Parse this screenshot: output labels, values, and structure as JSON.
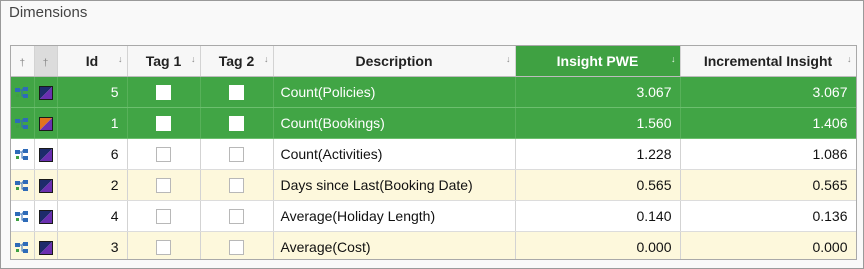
{
  "panel_title": "Dimensions",
  "columns": {
    "pin1": "†",
    "pin2": "†",
    "id": "Id",
    "tag1": "Tag 1",
    "tag2": "Tag 2",
    "description": "Description",
    "insight_pwe": "Insight PWE",
    "incremental_insight": "Incremental Insight"
  },
  "pin_glyph": "↓",
  "colors": {
    "selected_row": "#41a545",
    "alt_row": "#fdf8dc",
    "active_header": "#3fa142"
  },
  "rows": [
    {
      "id": "5",
      "tag1": false,
      "tag2": false,
      "description": "Count(Policies)",
      "insight_pwe": "3.067",
      "incremental": "3.067",
      "selected": true,
      "alt": false,
      "icon": "tree-node-icon",
      "swatch": "navy-purple-swatch-icon"
    },
    {
      "id": "1",
      "tag1": false,
      "tag2": false,
      "description": "Count(Bookings)",
      "insight_pwe": "1.560",
      "incremental": "1.406",
      "selected": true,
      "alt": false,
      "icon": "tree-node-icon",
      "swatch": "orange-purple-swatch-icon"
    },
    {
      "id": "6",
      "tag1": false,
      "tag2": false,
      "description": "Count(Activities)",
      "insight_pwe": "1.228",
      "incremental": "1.086",
      "selected": false,
      "alt": false,
      "icon": "tree-node-icon",
      "swatch": "navy-purple-swatch-icon"
    },
    {
      "id": "2",
      "tag1": false,
      "tag2": false,
      "description": "Days since Last(Booking Date)",
      "insight_pwe": "0.565",
      "incremental": "0.565",
      "selected": false,
      "alt": true,
      "icon": "tree-node-icon",
      "swatch": "navy-purple-swatch-icon"
    },
    {
      "id": "4",
      "tag1": false,
      "tag2": false,
      "description": "Average(Holiday Length)",
      "insight_pwe": "0.140",
      "incremental": "0.136",
      "selected": false,
      "alt": false,
      "icon": "tree-node-icon",
      "swatch": "navy-purple-swatch-icon"
    },
    {
      "id": "3",
      "tag1": false,
      "tag2": false,
      "description": "Average(Cost)",
      "insight_pwe": "0.000",
      "incremental": "0.000",
      "selected": false,
      "alt": true,
      "icon": "tree-node-icon",
      "swatch": "navy-purple-swatch-icon"
    }
  ]
}
